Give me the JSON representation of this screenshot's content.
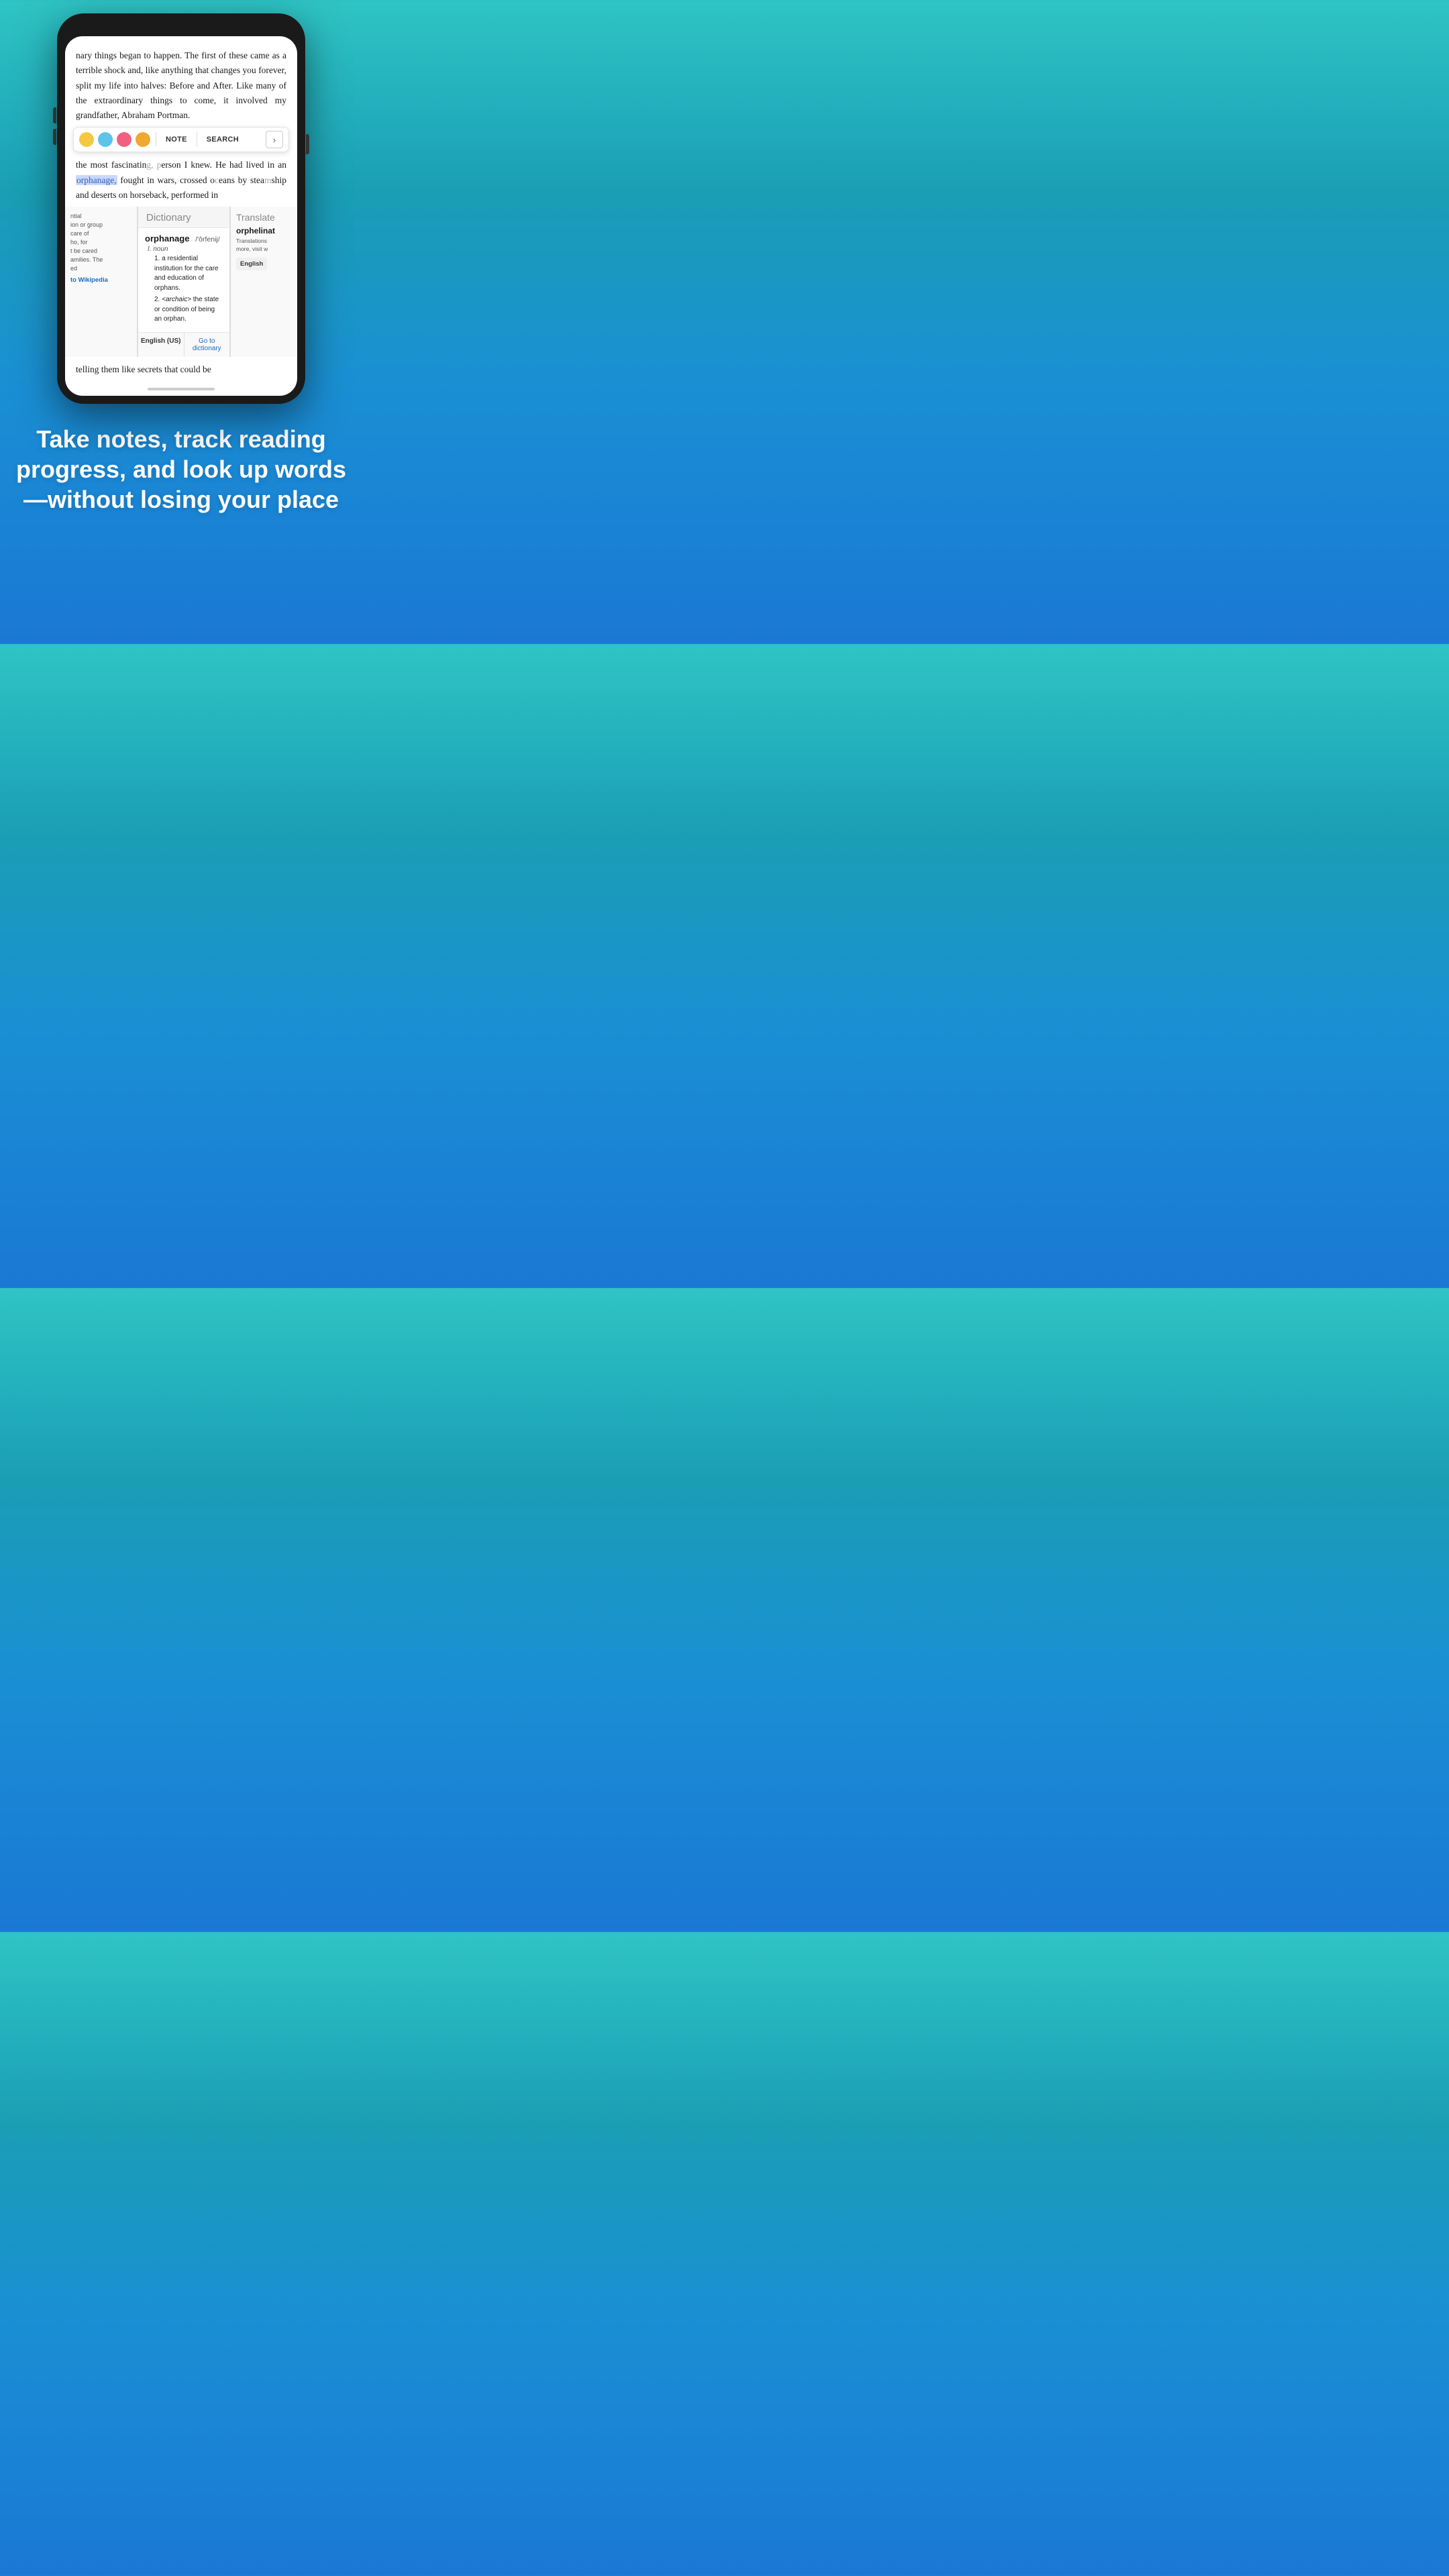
{
  "phone": {
    "book_text_top": "nary things began to happen. The first of these came as a terrible shock and, like anything that changes you forever, split my life into halves: Before and After. Like many of the extraordinary things to come, it involved my grandfather, Abraham Portman.",
    "book_text_middle_before": "the most fascinatin",
    "book_text_middle_highlight": "orphanage,",
    "book_text_middle_after": " fought in wars, crossed o",
    "book_text_middle_after2": "eans by stea",
    "book_text_middle_after3": "ship and deserts on horseback, performed in",
    "book_text_bottom": "telling them like secrets that could be",
    "toolbar": {
      "note_label": "NOTE",
      "search_label": "SEARCH",
      "arrow_label": "›"
    },
    "colors": {
      "yellow": "#f5c842",
      "blue": "#5cc4e8",
      "pink": "#f06080",
      "orange": "#f0a830"
    },
    "dictionary": {
      "header": "Dictionary",
      "word": "orphanage",
      "phonetic": "/'ôrfenij/",
      "pos": "noun",
      "definitions": [
        "a residential institution for the care and education of orphans.",
        "<archaic> the state or condition of being an orphan."
      ],
      "footer_lang": "English (US)",
      "footer_goto": "Go to dictionary"
    },
    "wikipedia": {
      "partial_text": "ntial\nion or group\ncare of\nho, for\nt be cared\namilies. The\ned",
      "link": "to Wikipedia"
    },
    "translate": {
      "header": "Translate",
      "word": "orphelinat",
      "partial_text": "Translations\nmore, visit w",
      "footer_lang": "English"
    },
    "home_bar": true
  },
  "headline": {
    "text": "Take notes, track reading progress, and look up words—without losing your place"
  }
}
